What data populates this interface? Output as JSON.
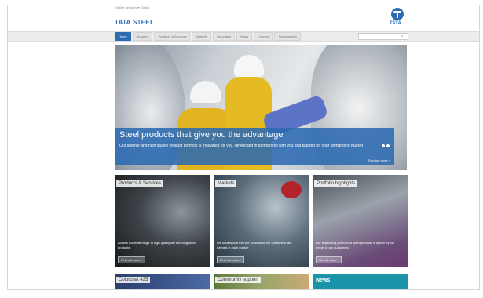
{
  "header": {
    "top_links": "Online services ▾   Global",
    "brand": "TATA STEEL",
    "logo_word": "TATA"
  },
  "nav": {
    "items": [
      "Home",
      "About us",
      "Products & Services",
      "Markets",
      "Innovation",
      "News",
      "Careers",
      "Sustainability"
    ],
    "active": 0,
    "search_placeholder": ""
  },
  "hero": {
    "title": "Steel products that give you the advantage",
    "body": "Our diverse and high quality product portfolio is innovated for you, developed in partnership with you and tailored for your demanding market",
    "more": "Find out more ›"
  },
  "tiles": [
    {
      "label": "Products & Services",
      "text": "Access our wide range of high quality flat and long steel products",
      "button": "Find out more ›"
    },
    {
      "label": "Markets",
      "text": "We understand that the success of our customers' are defined in each market",
      "button": "Find out more ›"
    },
    {
      "label": "Portfolio highlights",
      "text": "Our expanding portfolio of steel products is driven by the needs of our customers",
      "button": "See all more ›"
    }
  ],
  "bottom_tiles": [
    "Colorcoat 425",
    "Community support",
    "News"
  ],
  "colors": {
    "brand": "#2c6ab1",
    "news": "#1b94a9"
  }
}
